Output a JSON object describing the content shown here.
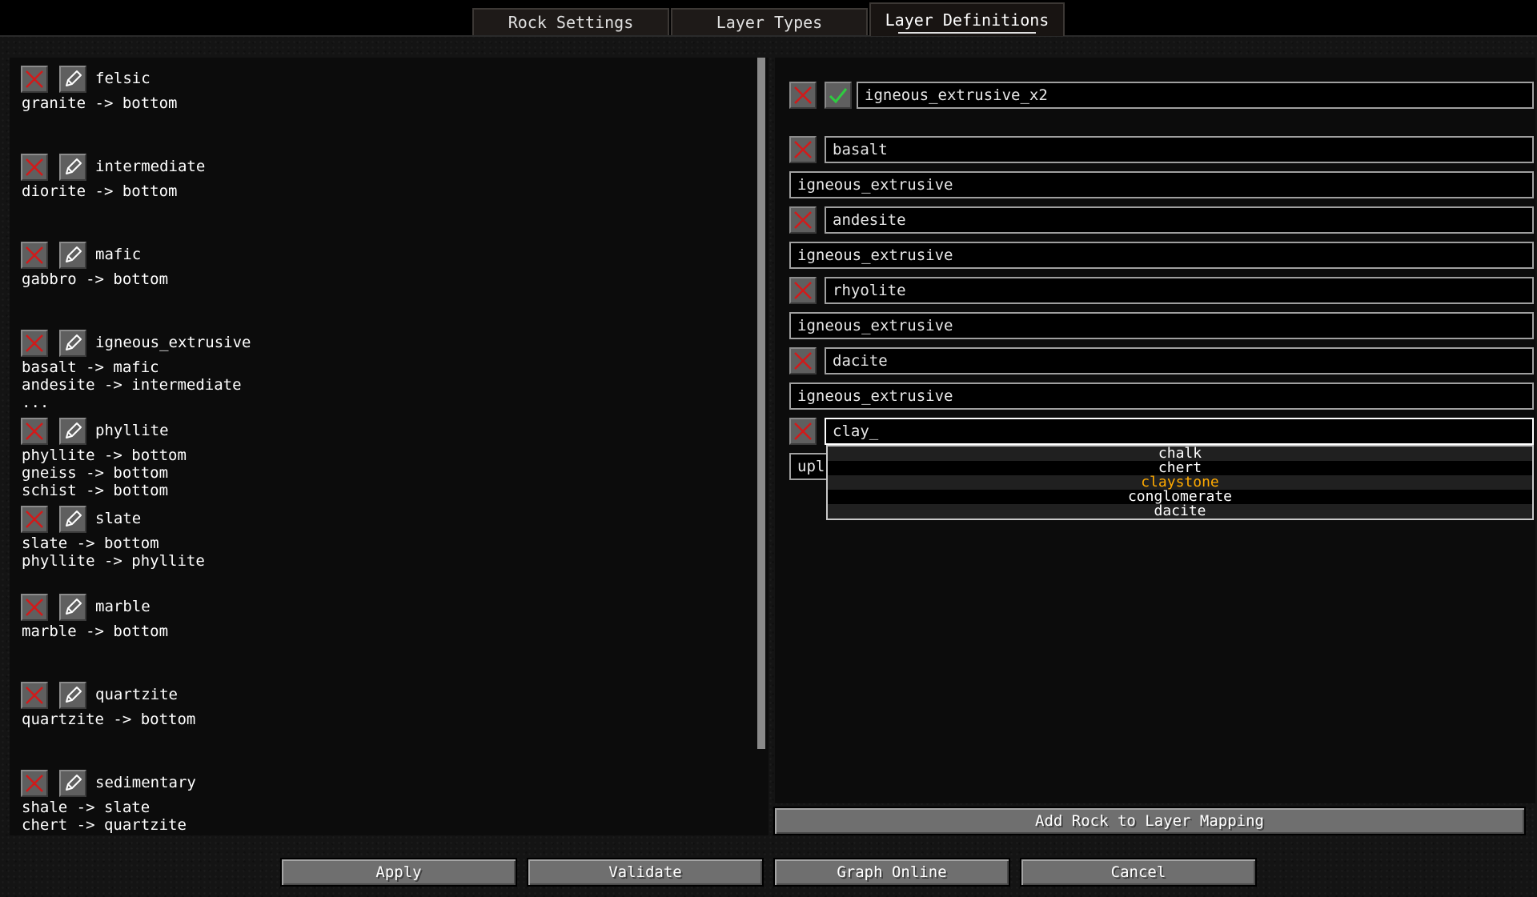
{
  "tabs": [
    {
      "label": "Rock Settings",
      "active": false
    },
    {
      "label": "Layer Types",
      "active": false
    },
    {
      "label": "Layer Definitions",
      "active": true
    }
  ],
  "layers": [
    {
      "name": "felsic",
      "lines": [
        "granite -> bottom"
      ]
    },
    {
      "name": "intermediate",
      "lines": [
        "diorite -> bottom"
      ]
    },
    {
      "name": "mafic",
      "lines": [
        "gabbro -> bottom"
      ]
    },
    {
      "name": "igneous_extrusive",
      "lines": [
        "basalt -> mafic",
        "andesite -> intermediate",
        "..."
      ]
    },
    {
      "name": "phyllite",
      "lines": [
        "phyllite -> bottom",
        "gneiss -> bottom",
        "schist -> bottom"
      ]
    },
    {
      "name": "slate",
      "lines": [
        "slate -> bottom",
        "phyllite -> phyllite"
      ]
    },
    {
      "name": "marble",
      "lines": [
        "marble -> bottom"
      ]
    },
    {
      "name": "quartzite",
      "lines": [
        "quartzite -> bottom"
      ]
    },
    {
      "name": "sedimentary",
      "lines": [
        "shale -> slate",
        "chert -> quartzite"
      ]
    }
  ],
  "editor": {
    "layer_name": "igneous_extrusive_x2",
    "mappings": [
      {
        "rock": "basalt",
        "layer": "igneous_extrusive"
      },
      {
        "rock": "andesite",
        "layer": "igneous_extrusive"
      },
      {
        "rock": "rhyolite",
        "layer": "igneous_extrusive"
      },
      {
        "rock": "dacite",
        "layer": "igneous_extrusive"
      },
      {
        "rock": "clay_",
        "layer": "upli"
      }
    ],
    "autocomplete": {
      "options": [
        "chalk",
        "chert",
        "claystone",
        "conglomerate",
        "dacite"
      ],
      "selected": "claystone",
      "selected_color": "#ffaa00"
    },
    "add_button": "Add Rock to Layer Mapping"
  },
  "footer": {
    "apply": "Apply",
    "validate": "Validate",
    "graph_online": "Graph Online",
    "cancel": "Cancel"
  },
  "icons": {
    "delete": "delete-x-icon",
    "edit": "pencil-icon",
    "confirm": "checkmark-icon"
  }
}
